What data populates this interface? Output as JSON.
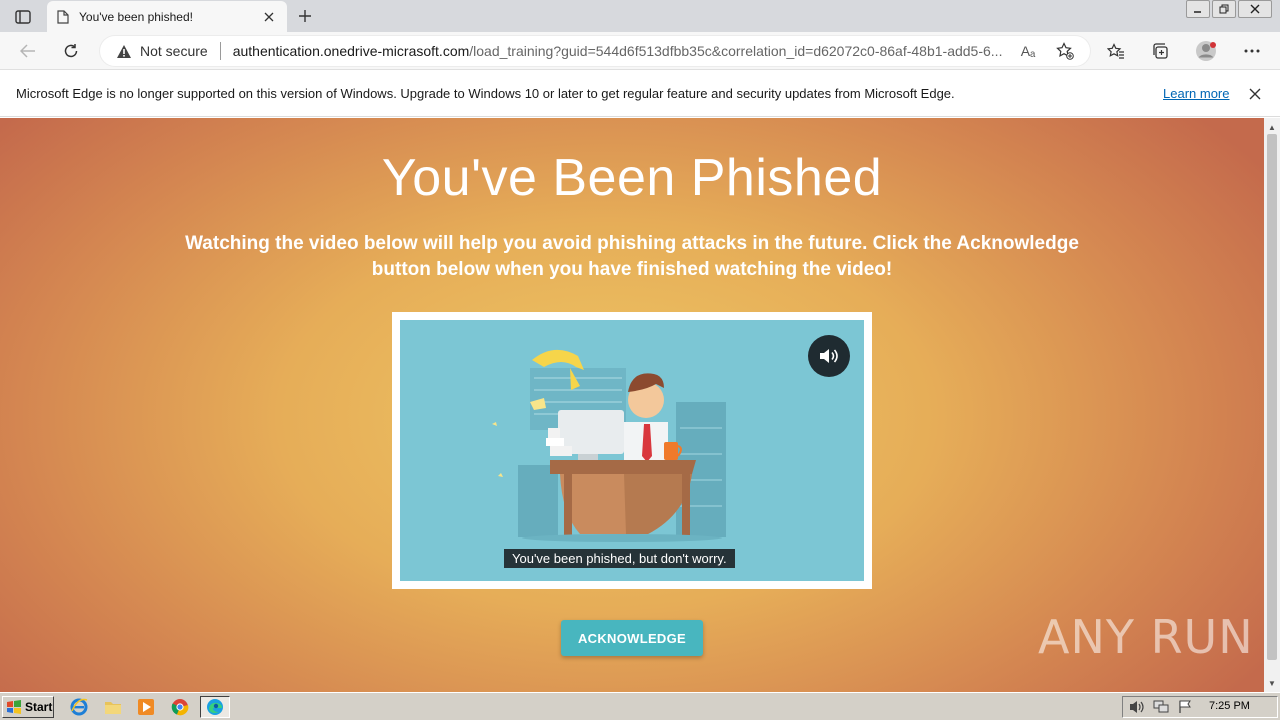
{
  "browser": {
    "tab_title": "You've been phished!",
    "security_label": "Not secure",
    "url_host": "authentication.onedrive-micrasoft.com",
    "url_path": "/load_training?guid=544d6f513dfbb35c&correlation_id=d62072c0-86af-48b1-add5-6...",
    "read_aloud_glyph": "Aₐ"
  },
  "infobar": {
    "message": "Microsoft Edge is no longer supported on this version of Windows. Upgrade to Windows 10 or later to get regular feature and security updates from Microsoft Edge.",
    "link": "Learn more"
  },
  "page": {
    "heading": "You've Been Phished",
    "subtitle": "Watching the video below will help you avoid phishing attacks in the future. Click the Acknowledge button below when you have finished watching the video!",
    "video_caption": "You've been phished, but don't worry.",
    "acknowledge_button": "ACKNOWLEDGE",
    "watermark": "ANY RUN"
  },
  "taskbar": {
    "start_label": "Start",
    "clock": "7:25 PM"
  },
  "colors": {
    "accent_button": "#48b6bf",
    "video_background": "#7cc6d4",
    "page_gradient_center": "#eec764",
    "page_gradient_edge": "#c46a4c",
    "link": "#0066b4"
  },
  "icons": {
    "tab_actions": "tab-actions-icon",
    "page": "page-icon",
    "back": "back-arrow-icon",
    "refresh": "refresh-icon",
    "warning": "warning-triangle-icon",
    "favorites_add": "add-favorite-icon",
    "favorites": "favorites-icon",
    "collections": "collections-icon",
    "profile": "profile-avatar-icon",
    "more": "more-dots-icon",
    "speaker": "speaker-icon"
  }
}
